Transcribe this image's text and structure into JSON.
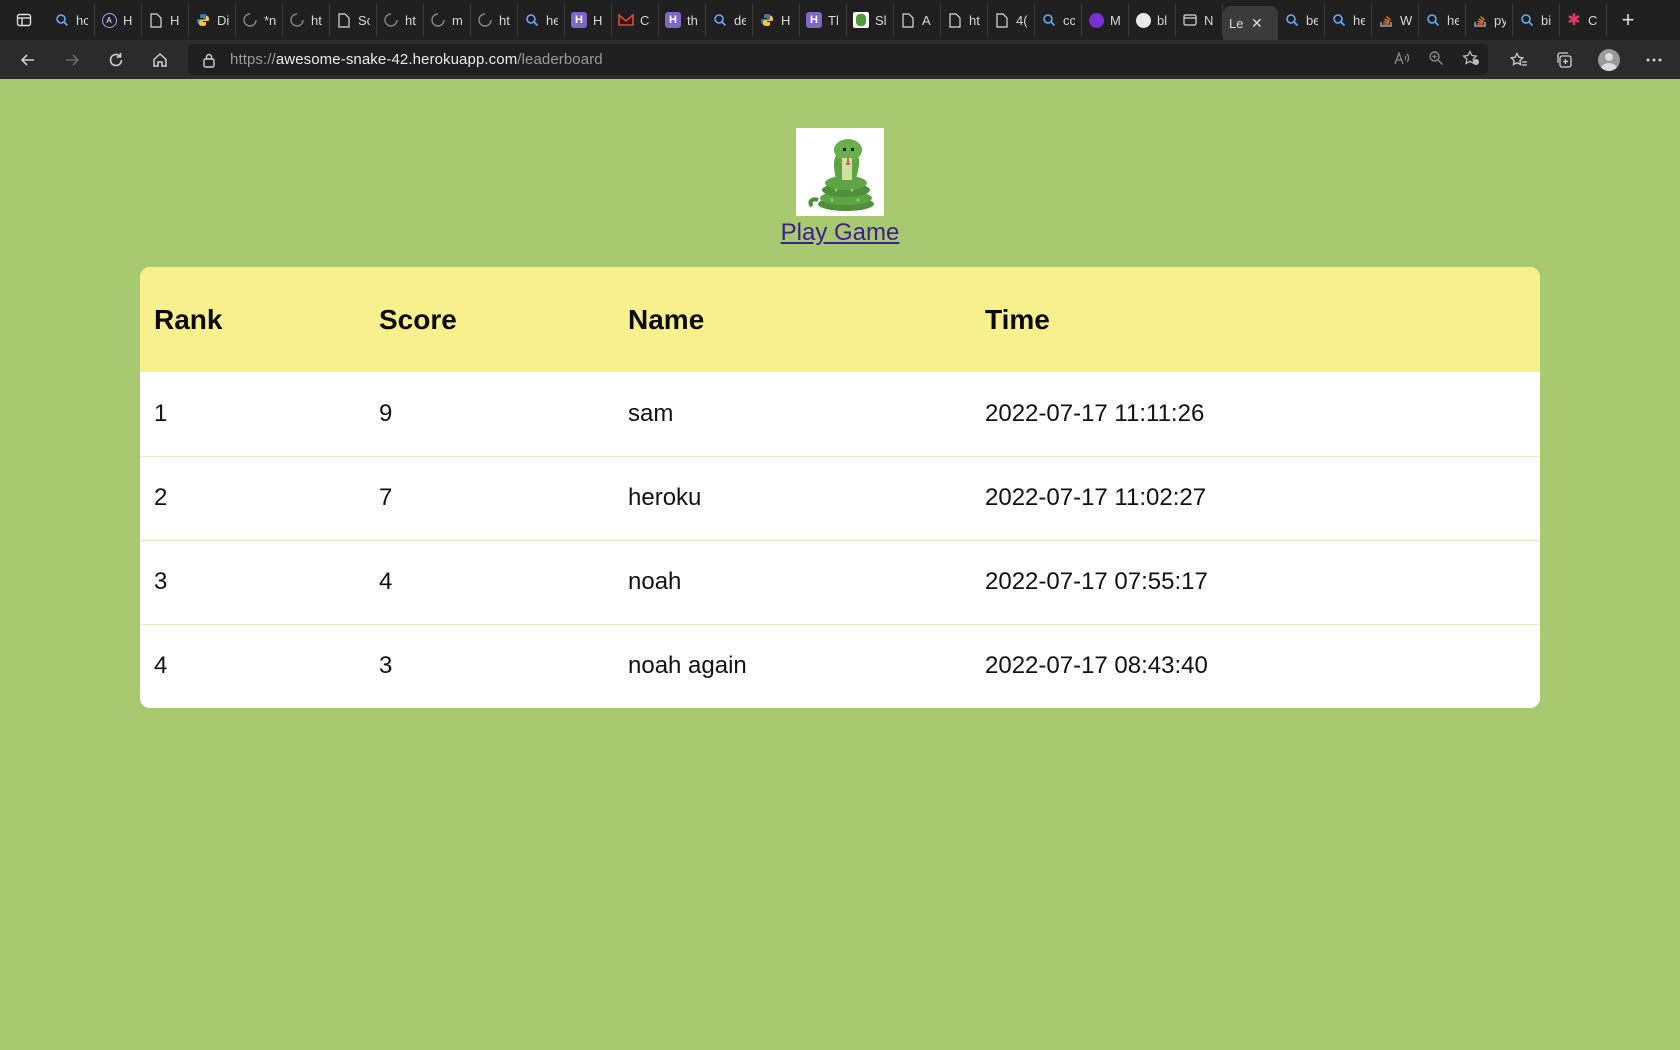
{
  "browser": {
    "tabs": [
      {
        "title": "hc",
        "icon": "search-icon"
      },
      {
        "title": "H",
        "icon": "app-icon"
      },
      {
        "title": "H",
        "icon": "page-icon"
      },
      {
        "title": "Di",
        "icon": "python-icon"
      },
      {
        "title": "*n",
        "icon": "loading-icon"
      },
      {
        "title": "ht",
        "icon": "loading-icon"
      },
      {
        "title": "Sc",
        "icon": "page-icon"
      },
      {
        "title": "ht",
        "icon": "loading-icon"
      },
      {
        "title": "m",
        "icon": "loading-icon"
      },
      {
        "title": "ht",
        "icon": "loading-icon"
      },
      {
        "title": "he",
        "icon": "search-icon"
      },
      {
        "title": "H",
        "icon": "heroku-icon"
      },
      {
        "title": "C",
        "icon": "gmail-icon"
      },
      {
        "title": "th",
        "icon": "heroku-icon"
      },
      {
        "title": "de",
        "icon": "search-icon"
      },
      {
        "title": "H",
        "icon": "python-icon"
      },
      {
        "title": "Tl",
        "icon": "heroku-icon"
      },
      {
        "title": "Sl",
        "icon": "snake-icon"
      },
      {
        "title": "A",
        "icon": "page-icon"
      },
      {
        "title": "ht",
        "icon": "page-icon"
      },
      {
        "title": "4(",
        "icon": "page-icon"
      },
      {
        "title": "cc",
        "icon": "search-icon"
      },
      {
        "title": "M",
        "icon": "shield-icon"
      },
      {
        "title": "bl",
        "icon": "github-icon"
      },
      {
        "title": "N",
        "icon": "window-icon"
      },
      {
        "title": "Le",
        "icon": "",
        "active": true
      },
      {
        "title": "be",
        "icon": "search-icon"
      },
      {
        "title": "he",
        "icon": "search-icon"
      },
      {
        "title": "W",
        "icon": "stack-icon"
      },
      {
        "title": "he",
        "icon": "search-icon"
      },
      {
        "title": "py",
        "icon": "stack-icon"
      },
      {
        "title": "bi",
        "icon": "search-icon"
      },
      {
        "title": "C",
        "icon": "asterisk-icon"
      }
    ],
    "url_prefix": "https://",
    "url_host": "awesome-snake-42.herokuapp.com",
    "url_path": "/leaderboard"
  },
  "page": {
    "play_link": "Play Game",
    "headers": [
      "Rank",
      "Score",
      "Name",
      "Time"
    ],
    "rows": [
      {
        "rank": "1",
        "score": "9",
        "name": "sam",
        "time": "2022-07-17 11:11:26"
      },
      {
        "rank": "2",
        "score": "7",
        "name": "heroku",
        "time": "2022-07-17 11:02:27"
      },
      {
        "rank": "3",
        "score": "4",
        "name": "noah",
        "time": "2022-07-17 07:55:17"
      },
      {
        "rank": "4",
        "score": "3",
        "name": "noah again",
        "time": "2022-07-17 08:43:40"
      }
    ]
  },
  "colors": {
    "page_bg": "#a8c96f",
    "header_bg": "#f8f08c",
    "link": "#3a1f8f"
  }
}
